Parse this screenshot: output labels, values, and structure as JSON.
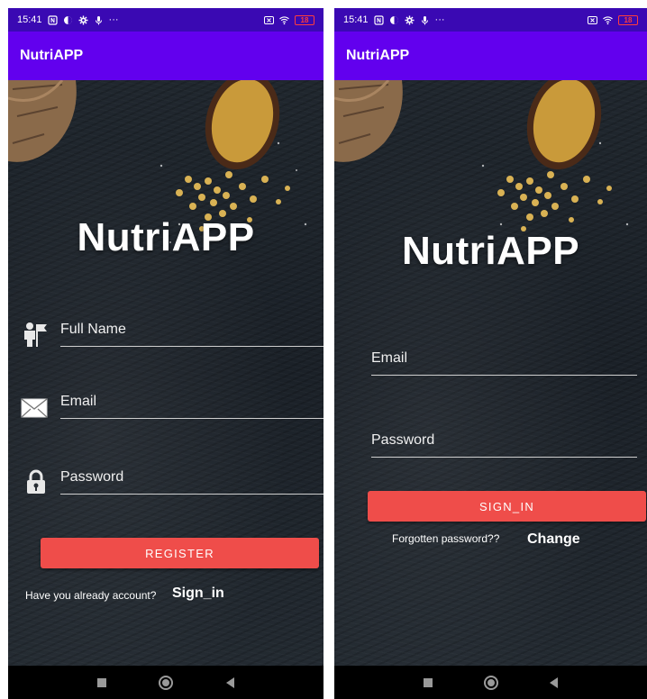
{
  "colors": {
    "status_bar": "#3a09b3",
    "app_bar": "#6200ee",
    "button": "#ef4d4a",
    "battery": "#ff3d3d",
    "nav_bar": "#000000"
  },
  "register_screen": {
    "status": {
      "time": "15:41",
      "dots": "···",
      "battery": "18",
      "icons": [
        "nfc-icon",
        "circle-half-icon",
        "gear-icon",
        "mic-icon",
        "x-box-icon",
        "wifi-icon",
        "battery-icon"
      ]
    },
    "app_bar_title": "NutriAPP",
    "brand_title": "NutriAPP",
    "fields": [
      {
        "label": "Full Name",
        "icon": "person-flag-icon"
      },
      {
        "label": "Email",
        "icon": "envelope-icon"
      },
      {
        "label": "Password",
        "icon": "lock-icon"
      }
    ],
    "button_label": "REGISTER",
    "prompt": "Have you already account?",
    "link": "Sign_in"
  },
  "signin_screen": {
    "status": {
      "time": "15:41",
      "dots": "···",
      "battery": "18",
      "icons": [
        "nfc-icon",
        "circle-half-icon",
        "gear-icon",
        "mic-icon",
        "x-box-icon",
        "wifi-icon",
        "battery-icon"
      ]
    },
    "app_bar_title": "NutriAPP",
    "brand_title": "NutriAPP",
    "fields": [
      {
        "label": "Email"
      },
      {
        "label": "Password"
      }
    ],
    "button_label": "SIGN_IN",
    "prompt": "Forgotten password??",
    "link": "Change"
  },
  "nav_icons": [
    "square-icon",
    "home-circle-icon",
    "back-triangle-icon"
  ]
}
